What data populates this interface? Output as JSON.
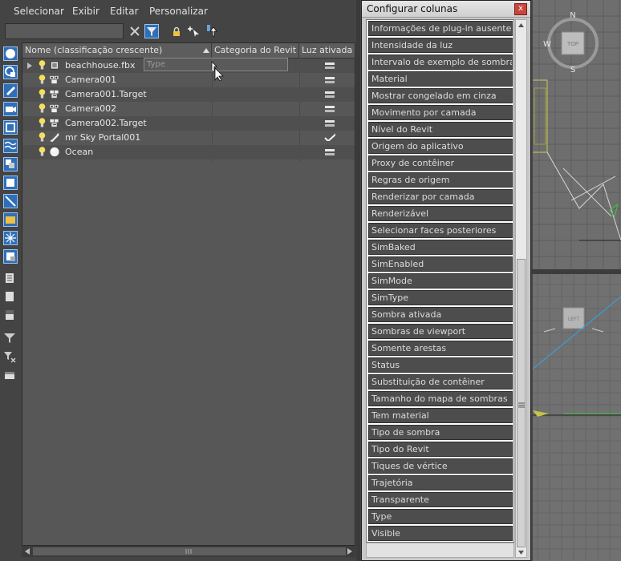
{
  "menu": {
    "items": [
      "Selecionar",
      "Exibir",
      "Editar",
      "Personalizar"
    ]
  },
  "search": {
    "value": "",
    "placeholder": ""
  },
  "tree": {
    "columns": [
      {
        "label": "Nome (classificação crescente)"
      },
      {
        "label": "Categoria do Revit"
      },
      {
        "label": "Luz ativada"
      }
    ],
    "drag_column_label": "Type",
    "rows": [
      {
        "name": "beachhouse.fbx",
        "icon": "container-icon",
        "light": "off"
      },
      {
        "name": "Camera001",
        "icon": "camera-icon",
        "light": "off"
      },
      {
        "name": "Camera001.Target",
        "icon": "camera-target-icon",
        "light": "off"
      },
      {
        "name": "Camera002",
        "icon": "camera-icon",
        "light": "off"
      },
      {
        "name": "Camera002.Target",
        "icon": "camera-target-icon",
        "light": "off"
      },
      {
        "name": "mr Sky Portal001",
        "icon": "light-portal-icon",
        "light": "on"
      },
      {
        "name": "Ocean",
        "icon": "sphere-icon",
        "light": "off"
      }
    ]
  },
  "dialog": {
    "title": "Configurar colunas",
    "close_symbol": "x",
    "items": [
      "Informações de plug-in ausentes",
      "Intensidade da luz",
      "Intervalo de exemplo de sombra",
      "Material",
      "Mostrar congelado em cinza",
      "Movimento por camada",
      "Nível do Revit",
      "Origem do aplicativo",
      "Proxy de contêiner",
      "Regras de origem",
      "Renderizar por camada",
      "Renderizável",
      "Selecionar faces posteriores",
      "SimBaked",
      "SimEnabled",
      "SimMode",
      "SimType",
      "Sombra ativada",
      "Sombras de viewport",
      "Somente arestas",
      "Status",
      "Substituição de contêiner",
      "Tamanho do mapa de sombras",
      "Tem material",
      "Tipo de sombra",
      "Tipo do Revit",
      "Tiques de vértice",
      "Trajetória",
      "Transparente",
      "Type",
      "Visible"
    ]
  },
  "viewcube": {
    "compass": {
      "n": "N",
      "w": "W",
      "s": "S"
    },
    "top_label": "TOP",
    "left_label": "LEFT"
  },
  "colors": {
    "panel_bg": "#444444",
    "tree_bg": "#575757",
    "accent_blue": "#2f6fb8",
    "dialog_bg": "#c8c8c8",
    "list_item_bg": "#4d4d4d",
    "bulb_yellow": "#f4e05a"
  }
}
